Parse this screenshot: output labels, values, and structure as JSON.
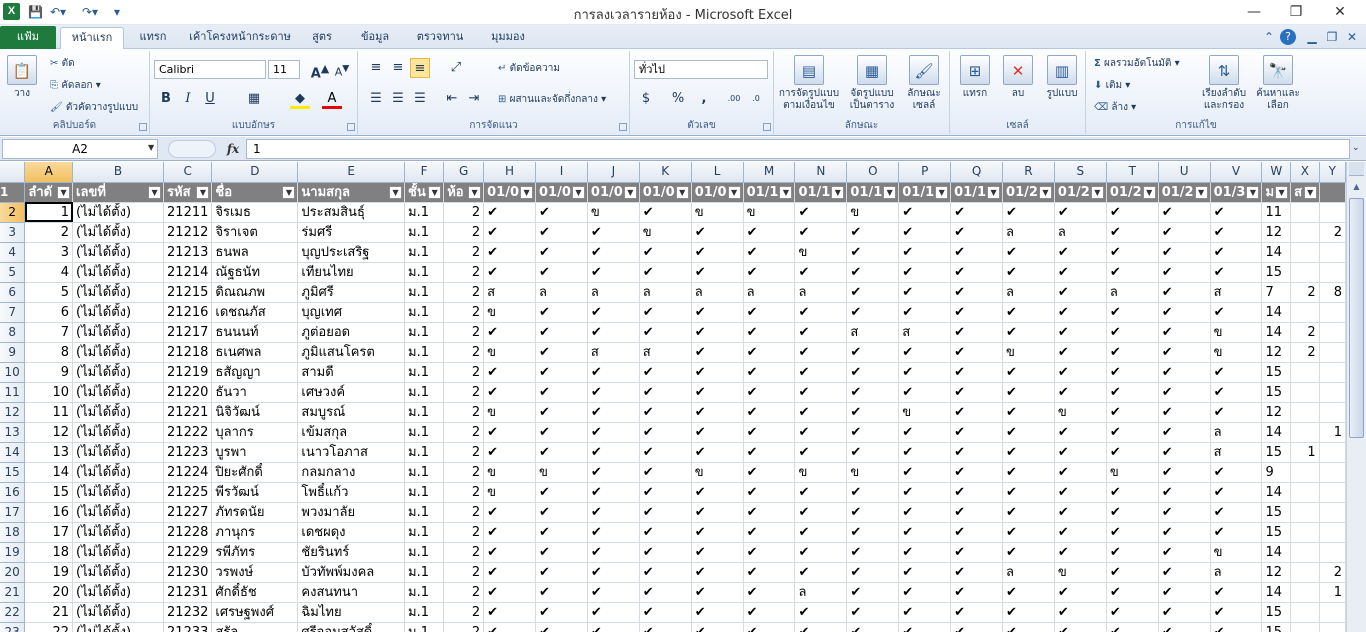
{
  "window": {
    "title": "การลงเวลารายห้อง  -  Microsoft Excel",
    "app_icon": "X",
    "qat": [
      "save-icon",
      "undo-icon",
      "redo-icon",
      "customize-icon"
    ]
  },
  "tabs": {
    "file": "แฟ้ม",
    "items": [
      "หน้าแรก",
      "แทรก",
      "เค้าโครงหน้ากระดาษ",
      "สูตร",
      "ข้อมูล",
      "ตรวจทาน",
      "มุมมอง"
    ]
  },
  "ribbon": {
    "clipboard": {
      "label": "คลิปบอร์ด",
      "paste": "วาง",
      "cut": "ตัด",
      "copy": "คัดลอก",
      "format_painter": "ตัวคัดวางรูปแบบ"
    },
    "font": {
      "label": "แบบอักษร",
      "name": "Calibri",
      "size": "11"
    },
    "alignment": {
      "label": "การจัดแนว",
      "wrap": "ตัดข้อความ",
      "merge": "ผสานและจัดกึ่งกลาง"
    },
    "number": {
      "label": "ตัวเลข",
      "format": "ทั่วไป"
    },
    "styles": {
      "label": "ลักษณะ",
      "cond_l1": "การจัดรูปแบบ",
      "cond_l2": "ตามเงื่อนไข",
      "table_l1": "จัดรูปแบบ",
      "table_l2": "เป็นตาราง",
      "cell_l1": "ลักษณะ",
      "cell_l2": "เซลล์"
    },
    "cells": {
      "label": "เซลล์",
      "insert": "แทรก",
      "delete": "ลบ",
      "format": "รูปแบบ"
    },
    "editing": {
      "label": "การแก้ไข",
      "autosum": "ผลรวมอัตโนมัติ",
      "fill": "เติม",
      "clear": "ล้าง",
      "sort_l1": "เรียงลำดับ",
      "sort_l2": "และกรอง",
      "find_l1": "ค้นหาและ",
      "find_l2": "เลือก"
    }
  },
  "formula_bar": {
    "name_box": "A2",
    "fx": "fx",
    "content": "1"
  },
  "sheet": {
    "columns": [
      "A",
      "B",
      "C",
      "D",
      "E",
      "F",
      "G",
      "H",
      "I",
      "J",
      "K",
      "L",
      "M",
      "N",
      "O",
      "P",
      "Q",
      "R",
      "S",
      "T",
      "U",
      "V",
      "W",
      "X",
      "Y"
    ],
    "header": [
      "ลำดั",
      "เลขที่",
      "รหัส",
      "ชื่อ",
      "นามสกุล",
      "ชั้น",
      "ห้อ",
      "01/0",
      "01/0",
      "01/0",
      "01/0",
      "01/0",
      "01/1",
      "01/1",
      "01/1",
      "01/1",
      "01/1",
      "01/2",
      "01/2",
      "01/2",
      "01/2",
      "01/3",
      "ม",
      "ส",
      ""
    ],
    "rows": [
      {
        "n": "2",
        "a": "1",
        "b": "(ไม่ได้ตั้ง)",
        "c": "21211",
        "d": "จิรเมธ",
        "e": "ประสมสินธุ์",
        "f": "ม.1",
        "g": "2",
        "att": [
          "✔",
          "✔",
          "ข",
          "✔",
          "ข",
          "ข",
          "✔",
          "ข",
          "✔",
          "✔",
          "✔",
          "✔",
          "✔",
          "✔",
          "✔"
        ],
        "w": "11",
        "x": "",
        "y": ""
      },
      {
        "n": "3",
        "a": "2",
        "b": "(ไม่ได้ตั้ง)",
        "c": "21212",
        "d": "จิราเจต",
        "e": "ร่มศรี",
        "f": "ม.1",
        "g": "2",
        "att": [
          "✔",
          "✔",
          "✔",
          "ข",
          "✔",
          "✔",
          "✔",
          "✔",
          "✔",
          "✔",
          "ล",
          "ล",
          "✔",
          "✔",
          "✔"
        ],
        "w": "12",
        "x": "",
        "y": "2"
      },
      {
        "n": "4",
        "a": "3",
        "b": "(ไม่ได้ตั้ง)",
        "c": "21213",
        "d": "ธนพล",
        "e": "บุญประเสริฐ",
        "f": "ม.1",
        "g": "2",
        "att": [
          "✔",
          "✔",
          "✔",
          "✔",
          "✔",
          "✔",
          "ข",
          "✔",
          "✔",
          "✔",
          "✔",
          "✔",
          "✔",
          "✔",
          "✔"
        ],
        "w": "14",
        "x": "",
        "y": ""
      },
      {
        "n": "5",
        "a": "4",
        "b": "(ไม่ได้ตั้ง)",
        "c": "21214",
        "d": "ณัฐธนัท",
        "e": "เทียนไทย",
        "f": "ม.1",
        "g": "2",
        "att": [
          "✔",
          "✔",
          "✔",
          "✔",
          "✔",
          "✔",
          "✔",
          "✔",
          "✔",
          "✔",
          "✔",
          "✔",
          "✔",
          "✔",
          "✔"
        ],
        "w": "15",
        "x": "",
        "y": ""
      },
      {
        "n": "6",
        "a": "5",
        "b": "(ไม่ได้ตั้ง)",
        "c": "21215",
        "d": "ดิณณภพ",
        "e": "ภูมิศรี",
        "f": "ม.1",
        "g": "2",
        "att": [
          "ส",
          "ล",
          "ล",
          "ล",
          "ล",
          "ล",
          "ล",
          "✔",
          "✔",
          "✔",
          "ล",
          "✔",
          "ล",
          "✔",
          "ส"
        ],
        "w": "7",
        "x": "2",
        "y": "8"
      },
      {
        "n": "7",
        "a": "6",
        "b": "(ไม่ได้ตั้ง)",
        "c": "21216",
        "d": "เดชณภัส",
        "e": "บุญเทศ",
        "f": "ม.1",
        "g": "2",
        "att": [
          "ข",
          "✔",
          "✔",
          "✔",
          "✔",
          "✔",
          "✔",
          "✔",
          "✔",
          "✔",
          "✔",
          "✔",
          "✔",
          "✔",
          "✔"
        ],
        "w": "14",
        "x": "",
        "y": ""
      },
      {
        "n": "8",
        "a": "7",
        "b": "(ไม่ได้ตั้ง)",
        "c": "21217",
        "d": "ธนนนท์",
        "e": "ภูต่อยอด",
        "f": "ม.1",
        "g": "2",
        "att": [
          "✔",
          "✔",
          "✔",
          "✔",
          "✔",
          "✔",
          "✔",
          "ส",
          "ส",
          "✔",
          "✔",
          "✔",
          "✔",
          "✔",
          "ข"
        ],
        "w": "14",
        "x": "2",
        "y": ""
      },
      {
        "n": "9",
        "a": "8",
        "b": "(ไม่ได้ตั้ง)",
        "c": "21218",
        "d": "ธเนศพล",
        "e": "ภูมิแสนโครต",
        "f": "ม.1",
        "g": "2",
        "att": [
          "ข",
          "✔",
          "ส",
          "ส",
          "✔",
          "✔",
          "✔",
          "✔",
          "✔",
          "✔",
          "ข",
          "✔",
          "✔",
          "✔",
          "ข"
        ],
        "w": "12",
        "x": "2",
        "y": ""
      },
      {
        "n": "10",
        "a": "9",
        "b": "(ไม่ได้ตั้ง)",
        "c": "21219",
        "d": "ธสัญญา",
        "e": "สามดี",
        "f": "ม.1",
        "g": "2",
        "att": [
          "✔",
          "✔",
          "✔",
          "✔",
          "✔",
          "✔",
          "✔",
          "✔",
          "✔",
          "✔",
          "✔",
          "✔",
          "✔",
          "✔",
          "✔"
        ],
        "w": "15",
        "x": "",
        "y": ""
      },
      {
        "n": "11",
        "a": "10",
        "b": "(ไม่ได้ตั้ง)",
        "c": "21220",
        "d": "ธันวา",
        "e": "เศษวงค์",
        "f": "ม.1",
        "g": "2",
        "att": [
          "✔",
          "✔",
          "✔",
          "✔",
          "✔",
          "✔",
          "✔",
          "✔",
          "✔",
          "✔",
          "✔",
          "✔",
          "✔",
          "✔",
          "✔"
        ],
        "w": "15",
        "x": "",
        "y": ""
      },
      {
        "n": "12",
        "a": "11",
        "b": "(ไม่ได้ตั้ง)",
        "c": "21221",
        "d": "นิจิวัฒน์",
        "e": "สมบูรณ์",
        "f": "ม.1",
        "g": "2",
        "att": [
          "ข",
          "✔",
          "✔",
          "✔",
          "✔",
          "✔",
          "✔",
          "✔",
          "ข",
          "✔",
          "✔",
          "ข",
          "✔",
          "✔",
          "✔"
        ],
        "w": "12",
        "x": "",
        "y": ""
      },
      {
        "n": "13",
        "a": "12",
        "b": "(ไม่ได้ตั้ง)",
        "c": "21222",
        "d": "บุลากร",
        "e": "เข้มสกุล",
        "f": "ม.1",
        "g": "2",
        "att": [
          "✔",
          "✔",
          "✔",
          "✔",
          "✔",
          "✔",
          "✔",
          "✔",
          "✔",
          "✔",
          "✔",
          "✔",
          "✔",
          "✔",
          "ล"
        ],
        "w": "14",
        "x": "",
        "y": "1"
      },
      {
        "n": "14",
        "a": "13",
        "b": "(ไม่ได้ตั้ง)",
        "c": "21223",
        "d": "บูรพา",
        "e": "เนาวโอภาส",
        "f": "ม.1",
        "g": "2",
        "att": [
          "✔",
          "✔",
          "✔",
          "✔",
          "✔",
          "✔",
          "✔",
          "✔",
          "✔",
          "✔",
          "✔",
          "✔",
          "✔",
          "✔",
          "ส"
        ],
        "w": "15",
        "x": "1",
        "y": ""
      },
      {
        "n": "15",
        "a": "14",
        "b": "(ไม่ได้ตั้ง)",
        "c": "21224",
        "d": "ปิยะศักดิ์",
        "e": "กลมกลาง",
        "f": "ม.1",
        "g": "2",
        "att": [
          "ข",
          "ข",
          "✔",
          "✔",
          "ข",
          "✔",
          "ข",
          "ข",
          "✔",
          "✔",
          "✔",
          "✔",
          "ข",
          "✔",
          "✔"
        ],
        "w": "9",
        "x": "",
        "y": ""
      },
      {
        "n": "16",
        "a": "15",
        "b": "(ไม่ได้ตั้ง)",
        "c": "21225",
        "d": "พีรวัฒน์",
        "e": "โพธิ์แก้ว",
        "f": "ม.1",
        "g": "2",
        "att": [
          "ข",
          "✔",
          "✔",
          "✔",
          "✔",
          "✔",
          "✔",
          "✔",
          "✔",
          "✔",
          "✔",
          "✔",
          "✔",
          "✔",
          "✔"
        ],
        "w": "14",
        "x": "",
        "y": ""
      },
      {
        "n": "17",
        "a": "16",
        "b": "(ไม่ได้ตั้ง)",
        "c": "21227",
        "d": "ภัทรดนัย",
        "e": "พวงมาลัย",
        "f": "ม.1",
        "g": "2",
        "att": [
          "✔",
          "✔",
          "✔",
          "✔",
          "✔",
          "✔",
          "✔",
          "✔",
          "✔",
          "✔",
          "✔",
          "✔",
          "✔",
          "✔",
          "✔"
        ],
        "w": "15",
        "x": "",
        "y": ""
      },
      {
        "n": "18",
        "a": "17",
        "b": "(ไม่ได้ตั้ง)",
        "c": "21228",
        "d": "ภานุกร",
        "e": "เดชผดุง",
        "f": "ม.1",
        "g": "2",
        "att": [
          "✔",
          "✔",
          "✔",
          "✔",
          "✔",
          "✔",
          "✔",
          "✔",
          "✔",
          "✔",
          "✔",
          "✔",
          "✔",
          "✔",
          "✔"
        ],
        "w": "15",
        "x": "",
        "y": ""
      },
      {
        "n": "19",
        "a": "18",
        "b": "(ไม่ได้ตั้ง)",
        "c": "21229",
        "d": "รพีภัทร",
        "e": "ชัยรินทร์",
        "f": "ม.1",
        "g": "2",
        "att": [
          "✔",
          "✔",
          "✔",
          "✔",
          "✔",
          "✔",
          "✔",
          "✔",
          "✔",
          "✔",
          "✔",
          "✔",
          "✔",
          "✔",
          "ข"
        ],
        "w": "14",
        "x": "",
        "y": ""
      },
      {
        "n": "20",
        "a": "19",
        "b": "(ไม่ได้ตั้ง)",
        "c": "21230",
        "d": "วรพงษ์",
        "e": "บัวทัพพ์มงคล",
        "f": "ม.1",
        "g": "2",
        "att": [
          "✔",
          "✔",
          "✔",
          "✔",
          "✔",
          "✔",
          "✔",
          "✔",
          "✔",
          "✔",
          "ล",
          "ข",
          "✔",
          "✔",
          "ล"
        ],
        "w": "12",
        "x": "",
        "y": "2"
      },
      {
        "n": "21",
        "a": "20",
        "b": "(ไม่ได้ตั้ง)",
        "c": "21231",
        "d": "ศักดิ์ธัช",
        "e": "คงสนทนา",
        "f": "ม.1",
        "g": "2",
        "att": [
          "✔",
          "✔",
          "✔",
          "✔",
          "✔",
          "✔",
          "ล",
          "✔",
          "✔",
          "✔",
          "✔",
          "✔",
          "✔",
          "✔",
          "✔"
        ],
        "w": "14",
        "x": "",
        "y": "1"
      },
      {
        "n": "22",
        "a": "21",
        "b": "(ไม่ได้ตั้ง)",
        "c": "21232",
        "d": "เศรษฐพงศ์",
        "e": "ฉิมไทย",
        "f": "ม.1",
        "g": "2",
        "att": [
          "✔",
          "✔",
          "✔",
          "✔",
          "✔",
          "✔",
          "✔",
          "✔",
          "✔",
          "✔",
          "✔",
          "✔",
          "✔",
          "✔",
          "✔"
        ],
        "w": "15",
        "x": "",
        "y": ""
      },
      {
        "n": "23",
        "a": "22",
        "b": "(ไม่ได้ตั้ง)",
        "c": "21233",
        "d": "สรัล",
        "e": "ศรีจอมสวัสดิ์",
        "f": "ม.1",
        "g": "2",
        "att": [
          "✔",
          "✔",
          "✔",
          "✔",
          "✔",
          "✔",
          "✔",
          "✔",
          "✔",
          "✔",
          "✔",
          "✔",
          "✔",
          "✔",
          "✔"
        ],
        "w": "15",
        "x": "",
        "y": ""
      }
    ]
  }
}
